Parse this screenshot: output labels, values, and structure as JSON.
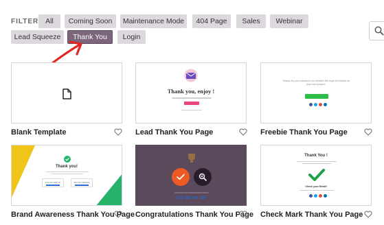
{
  "filter": {
    "label": "FILTER:",
    "options": [
      "All",
      "Coming Soon",
      "Maintenance Mode",
      "404 Page",
      "Sales",
      "Webinar",
      "Lead Squeeze",
      "Thank You",
      "Login"
    ],
    "active": "Thank You"
  },
  "templates": [
    {
      "title": "Blank Template"
    },
    {
      "title": "Lead Thank You Page",
      "heading": "Thank you, enjoy !"
    },
    {
      "title": "Freebie Thank You Page",
      "text": "Thanks for your interest in our freebie! We hope it's helpful for your next project."
    },
    {
      "title": "Brand Awareness Thank You Page",
      "heading": "Thank you!",
      "buttons": [
        "Connect With Us",
        "Visit Our Website"
      ]
    },
    {
      "title": "Congratulations Thank You Page"
    },
    {
      "title": "Check Mark Thank You Page",
      "heading": "Thank You !",
      "subheading": "Check your Email!"
    }
  ],
  "colors": {
    "pill_bg": "#ddd7de",
    "pill_active": "#7b667c",
    "arrow": "#e02525",
    "check_green": "#1fa24a",
    "orange": "#ee5a24",
    "purple_overlay": "#5b4a5c"
  }
}
